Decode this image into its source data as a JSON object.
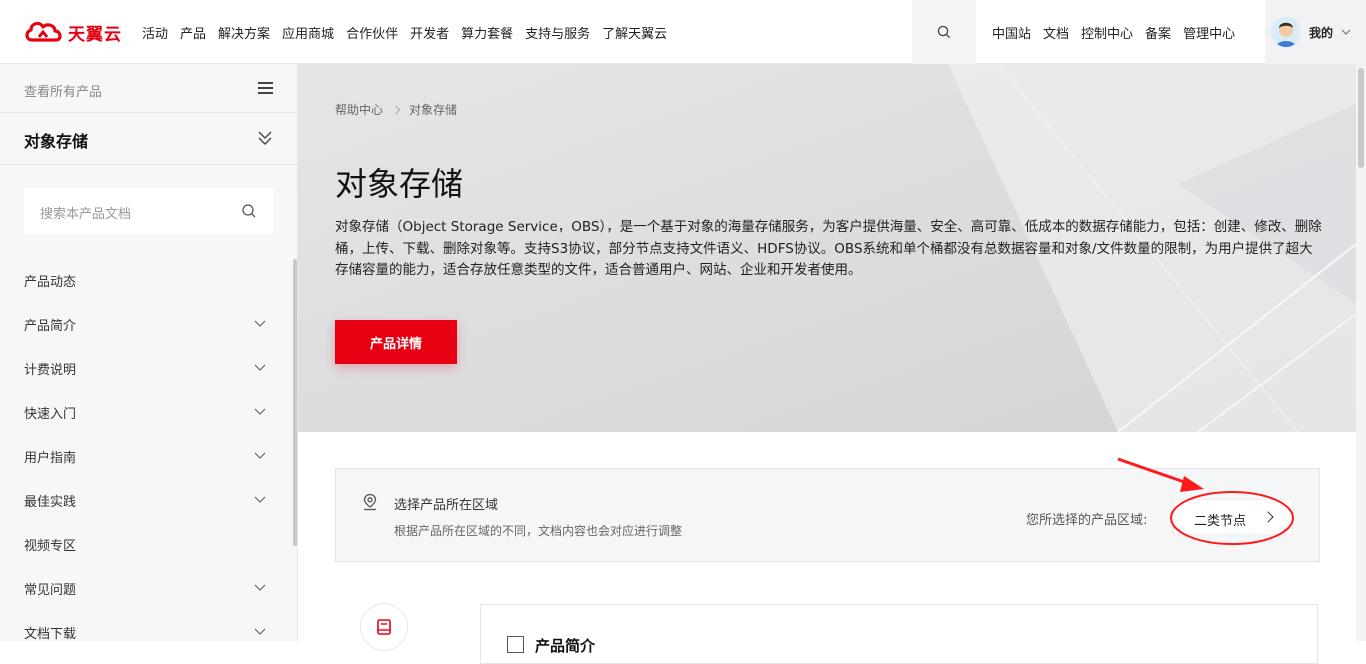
{
  "brand": {
    "name": "天翼云",
    "color": "#e60012"
  },
  "nav": {
    "menu": [
      "活动",
      "产品",
      "解决方案",
      "应用商城",
      "合作伙伴",
      "开发者",
      "算力套餐",
      "支持与服务",
      "了解天翼云"
    ],
    "right_links": [
      "中国站",
      "文档",
      "控制中心",
      "备案",
      "管理中心"
    ],
    "user_label": "我的"
  },
  "sidebar": {
    "all_products": "查看所有产品",
    "product_title": "对象存储",
    "search_placeholder": "搜索本产品文档",
    "items": [
      {
        "label": "产品动态",
        "expandable": false
      },
      {
        "label": "产品简介",
        "expandable": true
      },
      {
        "label": "计费说明",
        "expandable": true
      },
      {
        "label": "快速入门",
        "expandable": true
      },
      {
        "label": "用户指南",
        "expandable": true
      },
      {
        "label": "最佳实践",
        "expandable": true
      },
      {
        "label": "视频专区",
        "expandable": false
      },
      {
        "label": "常见问题",
        "expandable": true
      },
      {
        "label": "文档下载",
        "expandable": true
      }
    ]
  },
  "breadcrumb": [
    "帮助中心",
    "对象存储"
  ],
  "hero": {
    "title": "对象存储",
    "description": "对象存储（Object Storage Service，OBS），是一个基于对象的海量存储服务，为客户提供海量、安全、高可靠、低成本的数据存储能力，包括：创建、修改、删除桶，上传、下载、删除对象等。支持S3协议，部分节点支持文件语义、HDFS协议。OBS系统和单个桶都没有总数据容量和对象/文件数量的限制，为用户提供了超大存储容量的能力，适合存放任意类型的文件，适合普通用户、网站、企业和开发者使用。",
    "button": "产品详情"
  },
  "region": {
    "title": "选择产品所在区域",
    "subtitle": "根据产品所在区域的不同，文档内容也会对应进行调整",
    "selected_label": "您所选择的产品区域:",
    "selected_value": "二类节点"
  },
  "section": {
    "title": "产品简介"
  }
}
